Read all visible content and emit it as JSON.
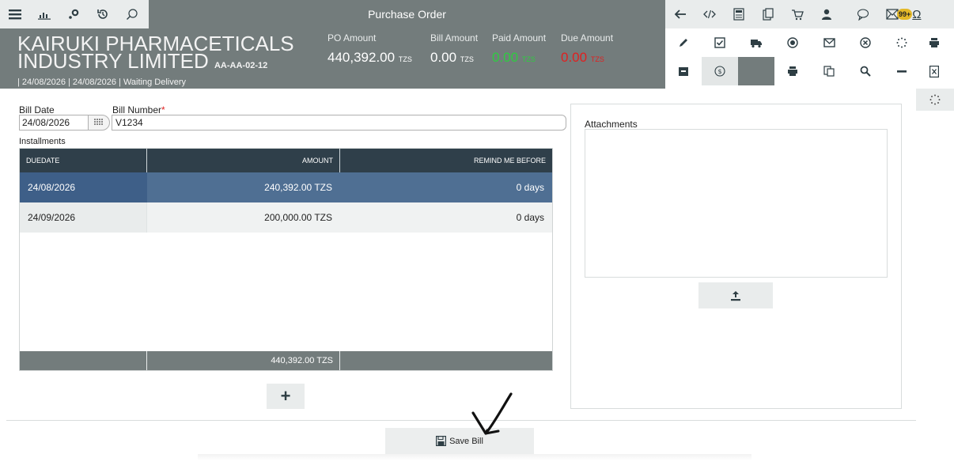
{
  "window": {
    "title": "Purchase Order"
  },
  "topbar": {
    "left_icons": [
      "menu-icon",
      "chart-icon",
      "key-icon",
      "history-icon",
      "search-icon"
    ],
    "right_icons": [
      "back-arrow-icon",
      "code-icon",
      "calculator-icon",
      "clipboard-icon",
      "cart-icon",
      "user-icon",
      "chat-icon",
      "mail-icon"
    ],
    "badge": "99+"
  },
  "header": {
    "company_line1": "KAIRUKI PHARMACETICALS",
    "company_line2": "INDUSTRY LIMITED",
    "code": "AA-AA-02-12",
    "subline": "| 24/08/2026 | 24/08/2026 | Waiting Delivery",
    "amounts": [
      {
        "label": "PO Amount",
        "value": "440,392.00",
        "currency": "TZS",
        "color": "#ffffff"
      },
      {
        "label": "Bill Amount",
        "value": "0.00",
        "currency": "TZS",
        "color": "#ffffff"
      },
      {
        "label": "Paid Amount",
        "value": "0.00",
        "currency": "TZS",
        "color": "#2ecc40"
      },
      {
        "label": "Due Amount",
        "value": "0.00",
        "currency": "TZS",
        "color": "#e02020"
      }
    ]
  },
  "actions": {
    "row1": [
      "pencil-icon",
      "checkbox-icon",
      "truck-icon",
      "radio-icon",
      "envelope-icon",
      "cancel-icon",
      "spinner-icon"
    ],
    "row2": [
      "archive-icon",
      "dollar-icon",
      "",
      "print-icon",
      "copy-icon",
      "search-icon",
      "minus-icon"
    ],
    "side": [
      "print-icon",
      "excel-icon"
    ]
  },
  "form": {
    "bill_date_label": "Bill Date",
    "bill_date_value": "24/08/2026",
    "bill_number_label": "Bill Number",
    "bill_number_required": "*",
    "bill_number_value": "V1234",
    "installments_label": "Installments"
  },
  "installments": {
    "columns": [
      "DUEDATE",
      "AMOUNT",
      "REMIND ME BEFORE"
    ],
    "rows": [
      {
        "duedate": "24/08/2026",
        "amount": "240,392.00 TZS",
        "remind": "0 days"
      },
      {
        "duedate": "24/09/2026",
        "amount": "200,000.00 TZS",
        "remind": "0 days"
      }
    ],
    "total": "440,392.00 TZS",
    "add_label": "+"
  },
  "attachments": {
    "title": "Attachments"
  },
  "footer": {
    "save_label": "Save Bill"
  }
}
